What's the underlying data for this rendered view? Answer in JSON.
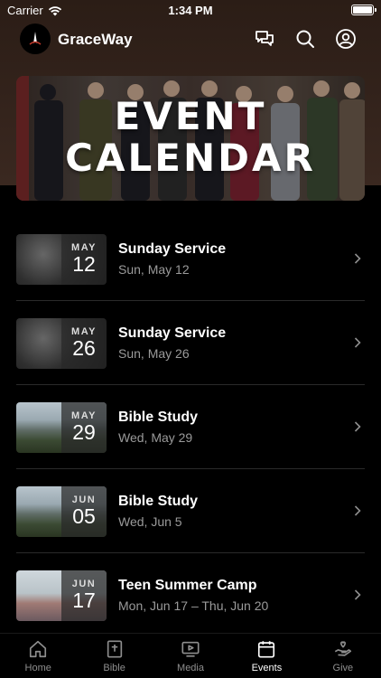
{
  "status_bar": {
    "carrier": "Carrier",
    "time": "1:34 PM"
  },
  "header": {
    "title": "GraceWay",
    "icons": [
      "chat-icon",
      "search-icon",
      "profile-icon"
    ]
  },
  "banner": {
    "line1": "EVENT",
    "line2": "CALENDAR"
  },
  "events": [
    {
      "month": "MAY",
      "day": "12",
      "title": "Sunday Service",
      "subtitle": "Sun, May 12"
    },
    {
      "month": "MAY",
      "day": "26",
      "title": "Sunday Service",
      "subtitle": "Sun, May 26"
    },
    {
      "month": "MAY",
      "day": "29",
      "title": "Bible Study",
      "subtitle": "Wed, May 29"
    },
    {
      "month": "JUN",
      "day": "05",
      "title": "Bible Study",
      "subtitle": "Wed, Jun 5"
    },
    {
      "month": "JUN",
      "day": "17",
      "title": "Teen Summer Camp",
      "subtitle": "Mon, Jun 17 – Thu, Jun 20"
    }
  ],
  "tabs": [
    {
      "label": "Home",
      "icon": "home-icon"
    },
    {
      "label": "Bible",
      "icon": "bible-icon"
    },
    {
      "label": "Media",
      "icon": "media-icon"
    },
    {
      "label": "Events",
      "icon": "calendar-icon",
      "active": true
    },
    {
      "label": "Give",
      "icon": "give-icon"
    }
  ],
  "colors": {
    "background": "#000000",
    "header_bg": "#2b1d16",
    "inactive_tab": "#8e8e8e",
    "subtitle": "#9a9a9a"
  }
}
